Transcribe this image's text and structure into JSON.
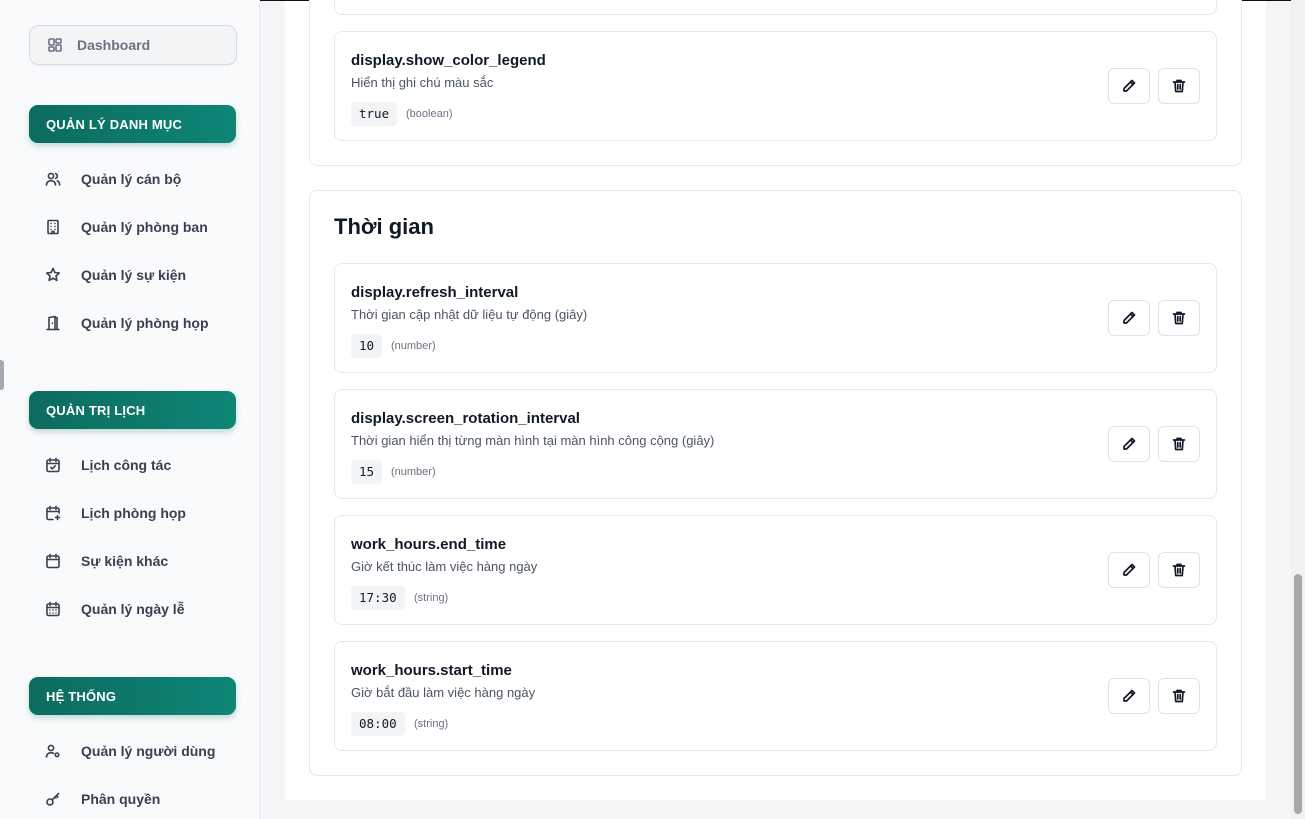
{
  "sidebar": {
    "dashboard": "Dashboard",
    "sections": [
      {
        "title": "QUẢN LÝ DANH MỤC",
        "items": [
          {
            "label": "Quản lý cán bộ",
            "icon": "users-icon"
          },
          {
            "label": "Quản lý phòng ban",
            "icon": "building-icon"
          },
          {
            "label": "Quản lý sự kiện",
            "icon": "star-icon"
          },
          {
            "label": "Quản lý phòng họp",
            "icon": "door-icon"
          }
        ]
      },
      {
        "title": "QUẢN TRỊ LỊCH",
        "items": [
          {
            "label": "Lịch công tác",
            "icon": "calendar-check-icon"
          },
          {
            "label": "Lịch phòng họp",
            "icon": "calendar-plus-icon"
          },
          {
            "label": "Sự kiện khác",
            "icon": "calendar-icon"
          },
          {
            "label": "Quản lý ngày lễ",
            "icon": "calendar-days-icon"
          }
        ]
      },
      {
        "title": "HỆ THỐNG",
        "items": [
          {
            "label": "Quản lý người dùng",
            "icon": "user-cog-icon"
          },
          {
            "label": "Phân quyền",
            "icon": "key-icon"
          }
        ]
      }
    ]
  },
  "display_section": {
    "items": [
      {
        "key": "display.show_color_legend",
        "description": "Hiển thị ghi chú màu sắc",
        "value": "true",
        "type": "(boolean)"
      }
    ]
  },
  "time_section": {
    "title": "Thời gian",
    "items": [
      {
        "key": "display.refresh_interval",
        "description": "Thời gian cập nhật dữ liệu tự động (giây)",
        "value": "10",
        "type": "(number)"
      },
      {
        "key": "display.screen_rotation_interval",
        "description": "Thời gian hiển thị từng màn hình tại màn hình công cộng (giây)",
        "value": "15",
        "type": "(number)"
      },
      {
        "key": "work_hours.end_time",
        "description": "Giờ kết thúc làm việc hàng ngày",
        "value": "17:30",
        "type": "(string)"
      },
      {
        "key": "work_hours.start_time",
        "description": "Giờ bắt đầu làm việc hàng ngày",
        "value": "08:00",
        "type": "(string)"
      }
    ]
  },
  "colors": {
    "accent": "#0e7a6c",
    "accent_dark": "#0c6b5e"
  },
  "actions": {
    "edit_icon": "pencil-icon",
    "delete_icon": "trash-icon"
  }
}
